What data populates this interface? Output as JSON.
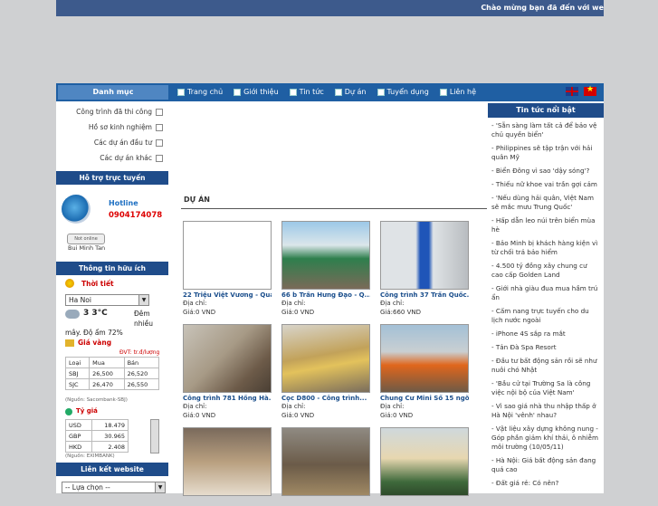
{
  "top": {
    "welcome": "Chào mừng bạn đã đến với we"
  },
  "nav": {
    "category_header": "Danh mục",
    "items": [
      "Trang chủ",
      "Giới thiệu",
      "Tin tức",
      "Dự án",
      "Tuyển dụng",
      "Liên hệ"
    ]
  },
  "categories": [
    "Công trình đã thi công",
    "Hồ sơ kinh nghiệm",
    "Các dự án đầu tư",
    "Các dự án khác"
  ],
  "support": {
    "header": "Hỗ trợ trực tuyến",
    "hotline_label": "Hotline",
    "phone": "0904174078",
    "status": "Not online",
    "name": "Bui Minh Tan"
  },
  "info": {
    "header": "Thông tin hữu ích",
    "weather_label": "Thời tiết",
    "city": "Ha Noi",
    "temp": "3 3°C",
    "cond1": "Đêm",
    "cond2": "nhiều",
    "cond3": "mây. Độ ẩm 72%",
    "gold_label": "Giá vàng",
    "gold_unit": "ĐVT: tr.đ/lượng",
    "gold_headers": [
      "Loại",
      "Mua",
      "Bán"
    ],
    "gold_rows": [
      [
        "SBJ",
        "26,500",
        "26,520"
      ],
      [
        "SJC",
        "26,470",
        "26,550"
      ]
    ],
    "gold_source": "(Nguồn: Sacombank-SBJ)",
    "fx_label": "Tỷ giá",
    "fx_rows": [
      [
        "USD",
        "18.479"
      ],
      [
        "GBP",
        "30.965"
      ],
      [
        "HKD",
        "2.408"
      ]
    ],
    "fx_source": "(Nguồn: EXIMBANK)"
  },
  "links": {
    "header": "Liên kết website",
    "select": "-- Lựa chọn --"
  },
  "main": {
    "section_title": "DỰ ÁN",
    "address_label": "Địa chỉ:",
    "projects": [
      {
        "title": "22 Triệu Việt Vương - Quan...",
        "price": "Giá:0 VND"
      },
      {
        "title": "66 b Trần Hưng Đạo - Q...",
        "price": "Giá:0 VND"
      },
      {
        "title": "Công trình 37 Trần Quốc...",
        "price": "Giá:660 VND"
      },
      {
        "title": "Công trình 781 Hồng Hà...",
        "price": "Giá:0 VND"
      },
      {
        "title": "Cọc D800 - Công trình...",
        "price": "Giá:0 VND"
      },
      {
        "title": "Chung Cư Mini Số 15 ngõ...",
        "price": "Giá:0 VND"
      }
    ]
  },
  "news": {
    "header": "Tin tức nổi bật",
    "items": [
      "- 'Sẵn sàng làm tất cả để bảo vệ chủ quyền biển'",
      "- Philippines sẽ tập trận với hải quân Mỹ",
      "- Biển Đông vì sao 'dậy sóng'?",
      "- Thiếu nữ khoe vai trần gợi cảm",
      "- 'Nếu dùng hải quân, Việt Nam sẽ mắc mưu Trung Quốc'",
      "- Hấp dẫn leo núi trên biển mùa hè",
      "- Bảo Minh bị khách hàng kiện vì từ chối trả bảo hiểm",
      "- 4.500 tỷ đồng xây chung cư cao cấp Golden Land",
      "- Giới nhà giàu đua mua hầm trú ẩn",
      "- Cấm nang trực tuyến cho du lịch nước ngoài",
      "- iPhone 4S sắp ra mắt",
      "- Tản Đà Spa Resort",
      "- Đầu tư bất động sản rồi sẽ như nuôi chó Nhật",
      "- 'Bầu cử tại Trường Sa là công việc nội bộ của Việt Nam'",
      "- Vì sao giá nhà thu nhập thấp ở Hà Nội 'vênh' nhau?",
      "- Vật liệu xây dựng không nung - Góp phần giảm khí thải, ô nhiễm môi trường (10/05/11)",
      "- Hà Nội: Giá bất động sản đang quá cao",
      "- Đất giá rẻ: Có nên?"
    ]
  }
}
